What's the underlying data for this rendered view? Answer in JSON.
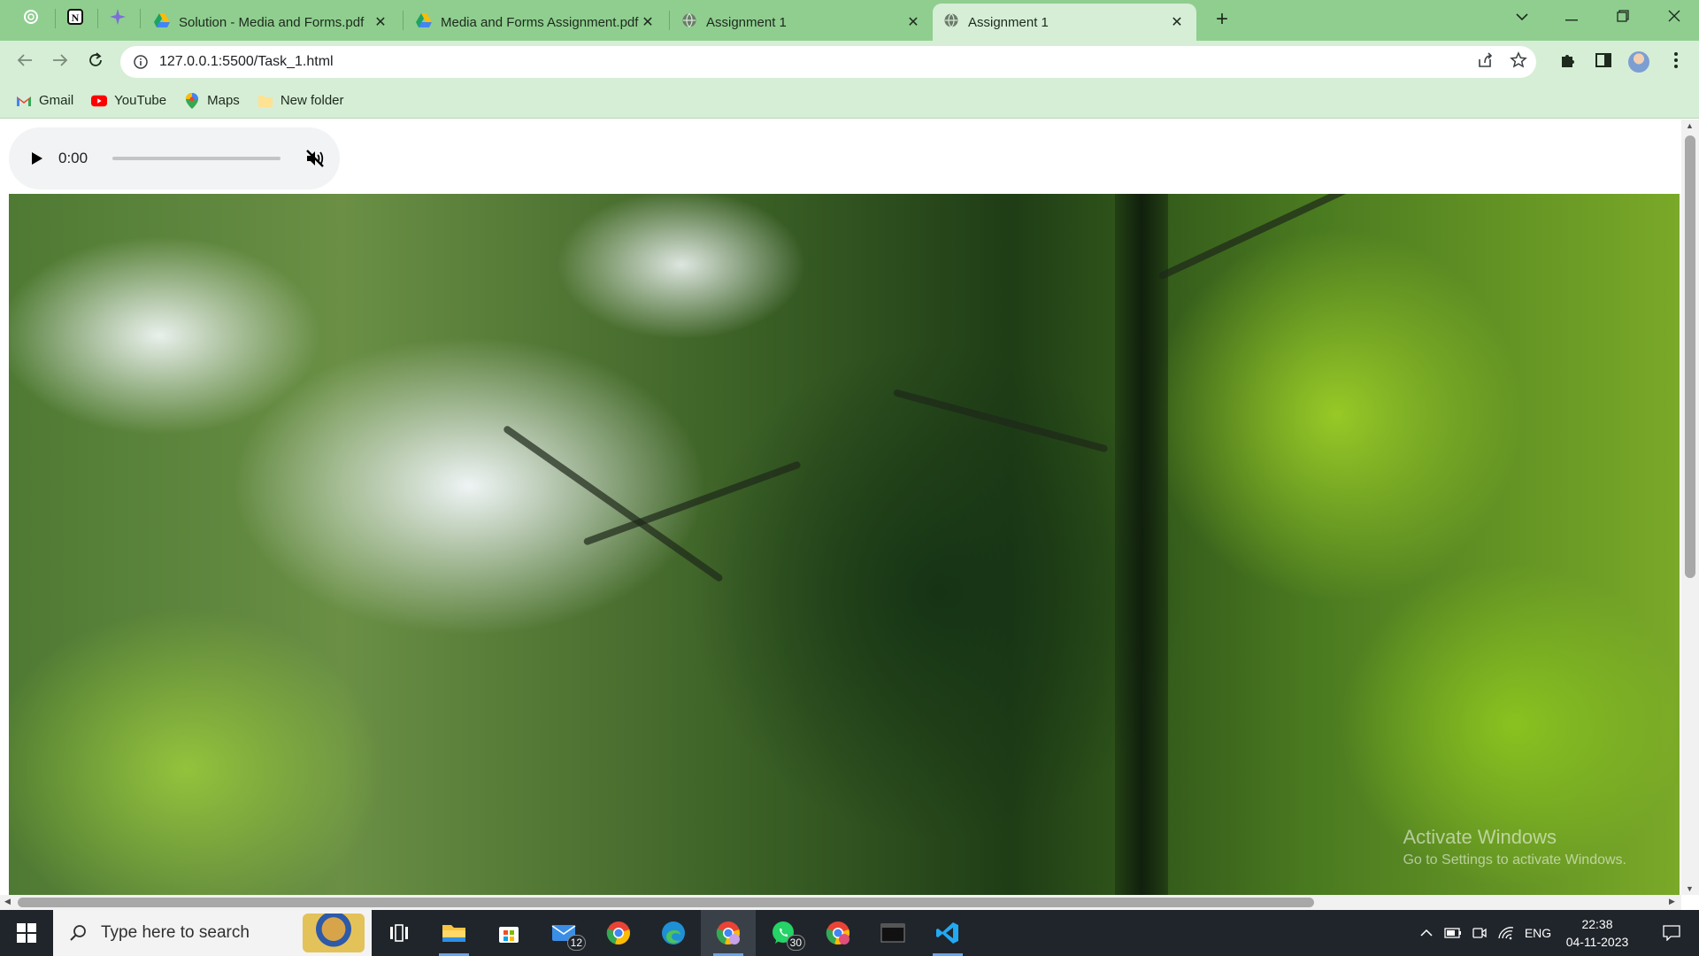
{
  "browser": {
    "tabs": [
      {
        "title": "Solution - Media and Forms.pdf",
        "active": false
      },
      {
        "title": "Media and Forms Assignment.pdf",
        "active": false
      },
      {
        "title": "Assignment 1",
        "active": false
      },
      {
        "title": "Assignment 1",
        "active": true
      }
    ],
    "url": "127.0.0.1:5500/Task_1.html",
    "bookmarks": [
      {
        "label": "Gmail",
        "icon": "gmail-icon"
      },
      {
        "label": "YouTube",
        "icon": "youtube-icon"
      },
      {
        "label": "Maps",
        "icon": "maps-icon"
      },
      {
        "label": "New folder",
        "icon": "folder-icon"
      }
    ]
  },
  "audio_player": {
    "time": "0:00",
    "progress": 0,
    "muted": true
  },
  "watermark": {
    "line1": "Activate Windows",
    "line2": "Go to Settings to activate Windows."
  },
  "taskbar": {
    "search_placeholder": "Type here to search",
    "mail_badge": "12",
    "whatsapp_badge": "30",
    "language": "ENG",
    "time": "22:38",
    "date": "04-11-2023"
  },
  "colors": {
    "tabstrip": "#8fce8f",
    "toolbar": "#d6eed6",
    "taskbar": "#20252b"
  }
}
